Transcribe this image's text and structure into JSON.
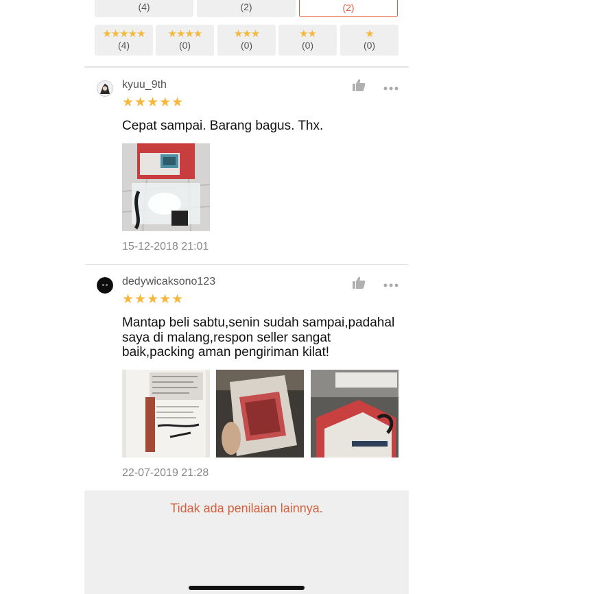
{
  "filters": {
    "top_row": [
      {
        "count": "(4)",
        "active": false
      },
      {
        "count": "(2)",
        "active": false
      },
      {
        "count": "(2)",
        "active": true
      }
    ],
    "star_row": [
      {
        "stars": "★★★★★",
        "count": "(4)"
      },
      {
        "stars": "★★★★",
        "count": "(0)"
      },
      {
        "stars": "★★★",
        "count": "(0)"
      },
      {
        "stars": "★★",
        "count": "(0)"
      },
      {
        "stars": "★",
        "count": "(0)"
      }
    ]
  },
  "reviews": [
    {
      "username": "kyuu_9th",
      "rating": 5,
      "rating_stars": "★★★★★",
      "comment": "Cepat sampai. Barang bagus. Thx.",
      "photo_count": 1,
      "timestamp": "15-12-2018 21:01"
    },
    {
      "username": "dedywicaksono123",
      "rating": 5,
      "rating_stars": "★★★★★",
      "comment": "Mantap beli sabtu,senin sudah sampai,padahal saya di malang,respon seller sangat baik,packing aman pengiriman kilat!",
      "photo_count": 3,
      "timestamp": "22-07-2019 21:28"
    }
  ],
  "footer": {
    "message": "Tidak ada penilaian lainnya."
  },
  "icons": {
    "like": "thumbs-up-icon",
    "more": "more-dots-icon",
    "star": "star-icon"
  },
  "colors": {
    "accent": "#e8593b",
    "star": "#f5b83d",
    "footer_text": "#d5603f",
    "filter_bg": "#efefef"
  }
}
